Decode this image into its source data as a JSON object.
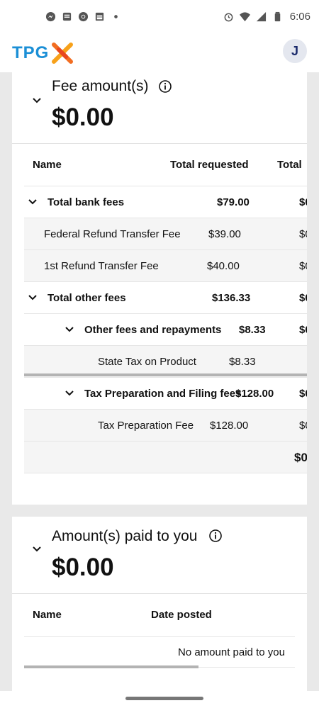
{
  "status_bar": {
    "time": "6:06",
    "left_icons": [
      "messenger-icon",
      "news-icon",
      "chrome-icon",
      "calendar-icon",
      "dot-icon"
    ],
    "right_icons": [
      "alarm-icon",
      "wifi-icon",
      "signal-icon",
      "battery-icon"
    ]
  },
  "header": {
    "logo_text": "TPG",
    "avatar_initial": "J"
  },
  "fees": {
    "title": "Fee amount(s)",
    "amount": "$0.00",
    "columns": [
      "Name",
      "Total requested",
      "Total"
    ],
    "rows": [
      {
        "name": "Total bank fees",
        "requested": "$79.00",
        "total": "$0",
        "bold": true,
        "expanded": true
      },
      {
        "name": "Federal Refund Transfer Fee",
        "requested": "$39.00",
        "total": "$0"
      },
      {
        "name": "1st Refund Transfer Fee",
        "requested": "$40.00",
        "total": "$0"
      },
      {
        "name": "Total other fees",
        "requested": "$136.33",
        "total": "$0",
        "bold": true,
        "expanded": true
      },
      {
        "name": "Other fees and repayments",
        "requested": "$8.33",
        "total": "$0",
        "bold": true,
        "expanded": true
      },
      {
        "name": "State Tax on Product",
        "requested": "$8.33",
        "total": ""
      },
      {
        "name": "Tax Preparation and Filing fees",
        "requested": "$128.00",
        "total": "$0",
        "bold": true,
        "expanded": true
      },
      {
        "name": "Tax Preparation Fee",
        "requested": "$128.00",
        "total": "$0"
      },
      {
        "name": "",
        "requested": "",
        "total": "$0",
        "bold": true
      }
    ]
  },
  "paid": {
    "title": "Amount(s) paid to you",
    "amount": "$0.00",
    "columns": [
      "Name",
      "Date posted"
    ],
    "empty_message": "No amount paid to you"
  }
}
